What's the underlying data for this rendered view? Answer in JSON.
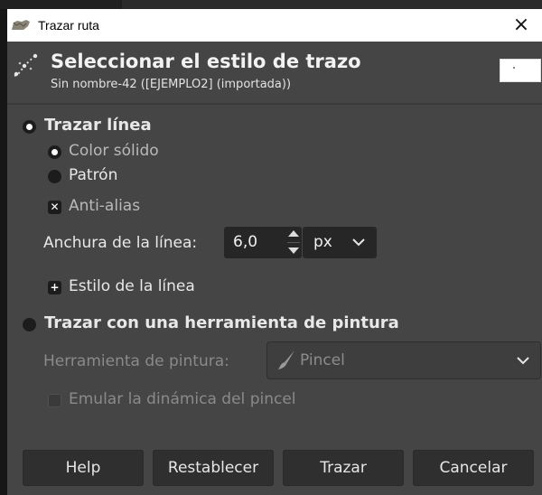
{
  "window": {
    "title": "Trazar ruta",
    "close_symbol": "×"
  },
  "header": {
    "title": "Seleccionar el estilo de trazo",
    "subtitle": "Sin nombre-42 ([EJEMPLO2] (importada))"
  },
  "stroke_line": {
    "label": "Trazar línea",
    "selected": true,
    "solid_color_label": "Color sólido",
    "pattern_label": "Patrón",
    "fill_mode_selected": "Color sólido",
    "antialias_label": "Anti-alias",
    "antialias_checked": true,
    "line_width_label": "Anchura de la línea:",
    "line_width_value": "6,0",
    "unit_value": "px",
    "line_style_label": "Estilo de la línea",
    "line_style_expanded": false
  },
  "paint_tool": {
    "label": "Trazar con una herramienta de pintura",
    "selected": false,
    "tool_label": "Herramienta de pintura:",
    "tool_value": "Pincel",
    "emulate_label": "Emular la dinámica del pincel",
    "emulate_checked": false
  },
  "buttons": {
    "help": "Help",
    "reset": "Restablecer",
    "stroke": "Trazar",
    "cancel": "Cancelar"
  },
  "icons": {
    "app": "gimp-icon",
    "header": "stroke-path-icon",
    "expander": "expand-plus-icon",
    "brush": "paintbrush-icon",
    "dropdown": "chevron-down-icon"
  },
  "colors": {
    "dialog_bg": "#454545",
    "field_bg": "#262626",
    "button_bg": "#2f2f2f",
    "titlebar_bg": "#ffffff"
  }
}
